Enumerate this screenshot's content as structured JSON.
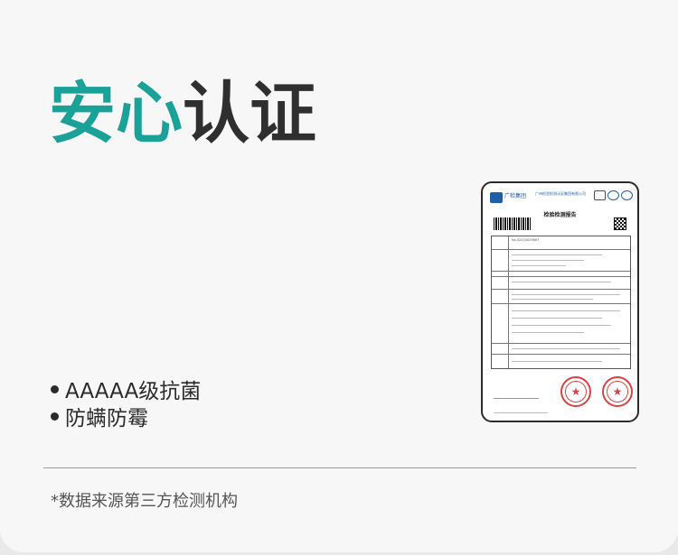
{
  "heading": {
    "accent": "安心",
    "rest": "认证",
    "accent_color": "#1aa198"
  },
  "features": [
    "AAAAA级抗菌",
    "防螨防霉"
  ],
  "note": "*数据来源第三方检测机构",
  "certificate": {
    "org_short": "广检集团",
    "org_full": "广州检验检测认证集团有限公司",
    "title": "检验检测报告",
    "report_no_label": "No.",
    "report_no": "S2020029667",
    "stamp_color": "#d8433f",
    "logo_color": "#1f5ea8"
  }
}
